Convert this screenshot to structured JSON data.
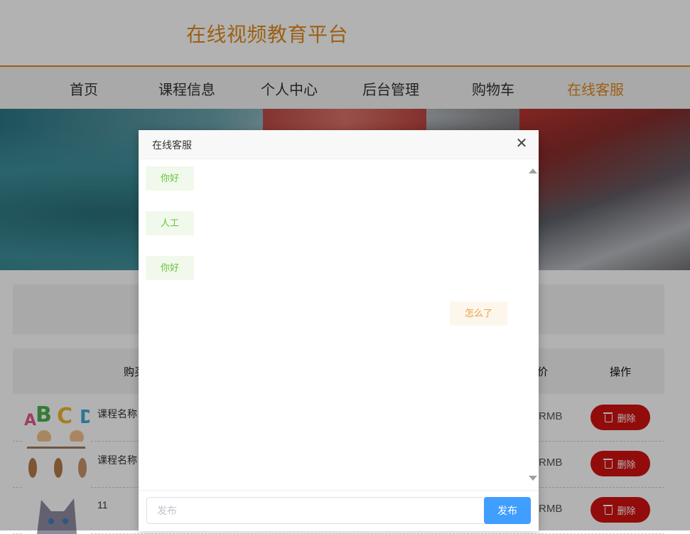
{
  "site": {
    "title": "在线视频教育平台"
  },
  "nav": {
    "items": [
      {
        "label": "首页"
      },
      {
        "label": "课程信息"
      },
      {
        "label": "个人中心"
      },
      {
        "label": "后台管理"
      },
      {
        "label": "购物车"
      },
      {
        "label": "在线客服",
        "active": true
      }
    ]
  },
  "table": {
    "headers": {
      "buy": "购买",
      "price": "价",
      "action": "操作"
    },
    "rows": [
      {
        "name": "课程名称",
        "price": "RMB",
        "delete_label": "删除"
      },
      {
        "name": "课程名称",
        "price": "RMB",
        "delete_label": "删除"
      },
      {
        "name": "11",
        "price": "RMB",
        "delete_label": "删除"
      }
    ]
  },
  "modal": {
    "title": "在线客服",
    "close_icon": "close-icon",
    "messages": [
      {
        "side": "left",
        "text": "你好"
      },
      {
        "side": "left",
        "text": "人工"
      },
      {
        "side": "left",
        "text": "你好"
      },
      {
        "side": "right",
        "text": "怎么了"
      }
    ],
    "input": {
      "placeholder": "发布",
      "value": ""
    },
    "send_label": "发布"
  },
  "colors": {
    "accent": "#e08a1e",
    "delete_button": "#d11212",
    "send_button": "#409eff",
    "user_bubble_bg": "#f0f9eb",
    "user_bubble_text": "#67c23a",
    "reply_bubble_bg": "#fdf6ec",
    "reply_bubble_text": "#e6a23c"
  }
}
